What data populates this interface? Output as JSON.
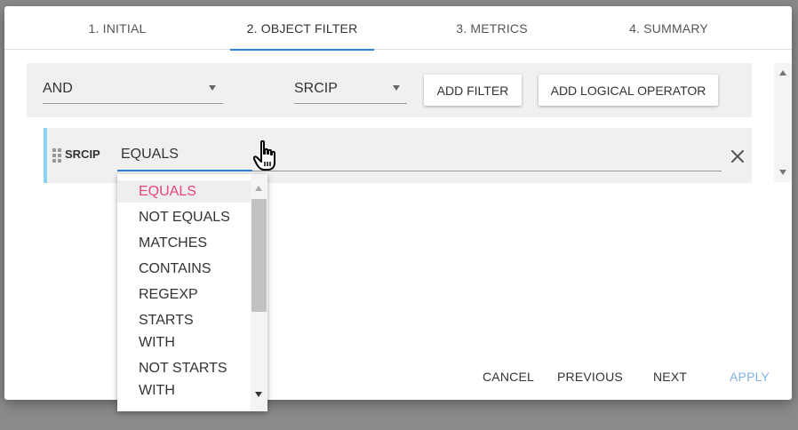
{
  "tabs": [
    {
      "label": "1. INITIAL"
    },
    {
      "label": "2. OBJECT FILTER",
      "active": true
    },
    {
      "label": "3. METRICS"
    },
    {
      "label": "4. SUMMARY"
    }
  ],
  "toolbar": {
    "logic_select": "AND",
    "field_select": "SRCIP",
    "add_filter_label": "ADD FILTER",
    "add_logical_operator_label": "ADD LOGICAL OPERATOR"
  },
  "filter": {
    "field_label": "SRCIP",
    "operator_value": "EQUALS"
  },
  "dropdown": {
    "options": [
      "EQUALS",
      "NOT EQUALS",
      "MATCHES",
      "CONTAINS",
      "REGEXP",
      "STARTS",
      "WITH",
      "NOT STARTS",
      "WITH"
    ],
    "selected": "EQUALS"
  },
  "footer": {
    "cancel_label": "CANCEL",
    "previous_label": "PREVIOUS",
    "next_label": "NEXT",
    "apply_label": "APPLY"
  },
  "colors": {
    "accent": "#2f80d9",
    "selected_option": "#e8457a",
    "row_marker": "#8ad4ee",
    "disabled": "#7fb0e8"
  }
}
